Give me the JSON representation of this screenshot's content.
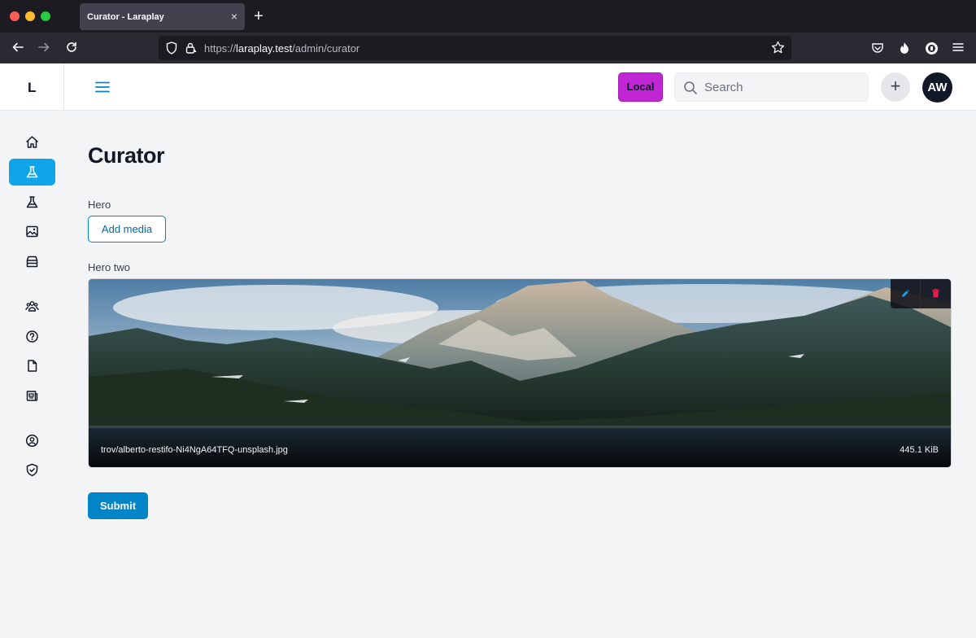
{
  "browser": {
    "tab_title": "Curator - Laraplay",
    "tab_close": "×",
    "new_tab": "+",
    "url_scheme": "https://",
    "url_host": "laraplay.test",
    "url_path": "/admin/curator"
  },
  "header": {
    "brand": "L",
    "environment_badge": "Local",
    "search_placeholder": "Search",
    "search_value": "",
    "add_button": "+",
    "avatar_initials": "AW"
  },
  "sidebar": {
    "items": [
      {
        "icon": "home-icon",
        "active": false
      },
      {
        "icon": "beaker-icon",
        "active": true
      },
      {
        "icon": "beaker-icon",
        "active": false
      },
      {
        "icon": "photo-icon",
        "active": false
      },
      {
        "icon": "archive-icon",
        "active": false
      },
      {
        "icon": "user-group-icon",
        "active": false
      },
      {
        "icon": "question-circle-icon",
        "active": false
      },
      {
        "icon": "document-icon",
        "active": false
      },
      {
        "icon": "newspaper-icon",
        "active": false
      },
      {
        "icon": "user-circle-icon",
        "active": false
      },
      {
        "icon": "shield-check-icon",
        "active": false
      }
    ]
  },
  "main": {
    "title": "Curator",
    "fields": {
      "hero_label": "Hero",
      "hero_button": "Add media",
      "hero_two_label": "Hero two",
      "media": {
        "file_name": "trov/alberto-restifo-Ni4NgA64TFQ-unsplash.jpg",
        "file_size": "445.1 KiB",
        "edit_icon": "pencil-icon",
        "delete_icon": "trash-icon"
      }
    },
    "submit_label": "Submit"
  },
  "colors": {
    "primary": "#0284c7",
    "active_sidebar": "#0ea5e9",
    "env_badge": "#c026d3",
    "delete": "#e11d48",
    "edit": "#0ea5e9"
  }
}
